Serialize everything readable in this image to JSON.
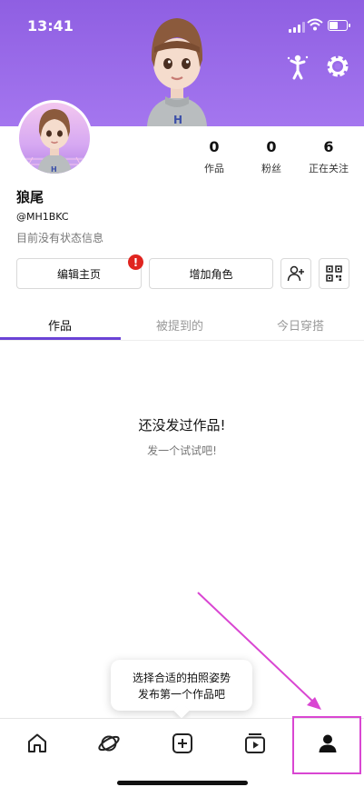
{
  "status_bar": {
    "time": "13:41"
  },
  "header": {
    "bg_color": "#9b6cec",
    "icons": [
      "pose-figure-icon",
      "gear-icon"
    ]
  },
  "profile": {
    "name": "狼尾",
    "handle": "@MH1BKC",
    "status_message": "目前没有状态信息"
  },
  "stats": [
    {
      "value": "0",
      "label": "作品"
    },
    {
      "value": "0",
      "label": "粉丝"
    },
    {
      "value": "6",
      "label": "正在关注"
    }
  ],
  "actions": {
    "edit_label": "编辑主页",
    "edit_badge": "!",
    "add_role_label": "增加角色",
    "icons": [
      "add-friend-icon",
      "qr-code-icon"
    ]
  },
  "tabs": [
    {
      "label": "作品",
      "active": true
    },
    {
      "label": "被提到的",
      "active": false
    },
    {
      "label": "今日穿搭",
      "active": false
    }
  ],
  "empty_state": {
    "title": "还没发过作品!",
    "subtitle": "发一个试试吧!"
  },
  "tooltip": {
    "line1": "选择合适的拍照姿势",
    "line2": "发布第一个作品吧"
  },
  "tab_bar": {
    "items": [
      "home-icon",
      "planet-icon",
      "create-icon",
      "video-icon",
      "profile-icon"
    ]
  },
  "accent_color": "#6b43d6",
  "annotation_color": "#d946d2"
}
